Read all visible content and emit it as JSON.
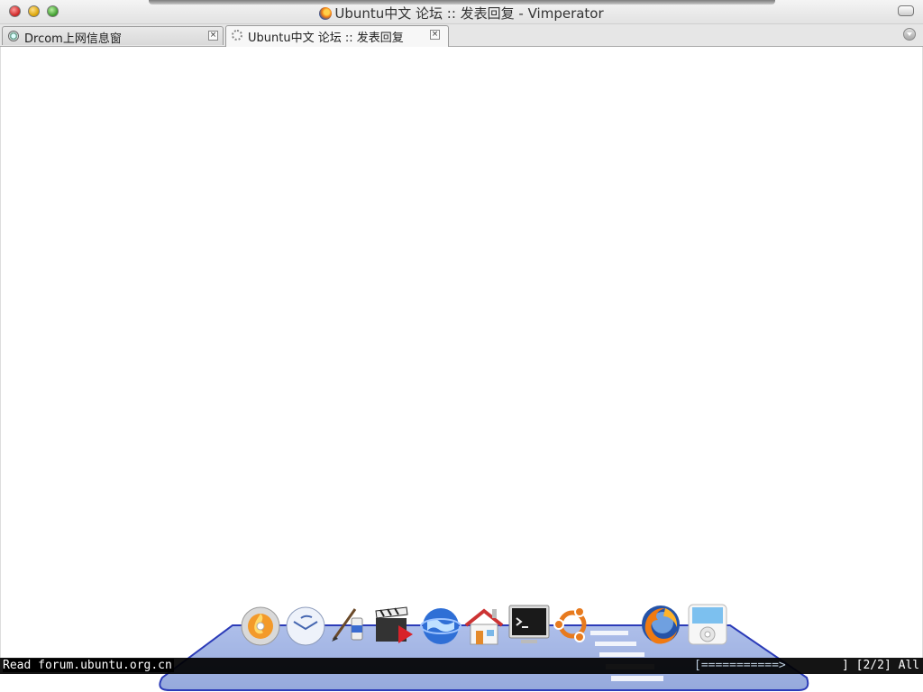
{
  "window": {
    "title": "Ubuntu中文 论坛 :: 发表回复 - Vimperator"
  },
  "tabs": [
    {
      "label": "Drcom上网信息窗",
      "close": "×"
    },
    {
      "label": "Ubuntu中文 论坛 :: 发表回复",
      "close": "×"
    }
  ],
  "statusbar": {
    "message": "Read forum.ubuntu.org.cn",
    "progress": "[===========>",
    "position": "] [2/2] All"
  },
  "dock": {
    "items": [
      {
        "icon": "disc-burner-icon"
      },
      {
        "icon": "mail-client-icon"
      },
      {
        "icon": "paint-tools-icon"
      },
      {
        "icon": "video-editor-icon"
      },
      {
        "icon": "globe-browser-icon"
      },
      {
        "icon": "home-folder-icon"
      },
      {
        "icon": "terminal-icon"
      },
      {
        "icon": "ubuntu-logo-icon"
      },
      {
        "icon": "firefox-icon"
      },
      {
        "icon": "music-player-icon"
      }
    ]
  }
}
